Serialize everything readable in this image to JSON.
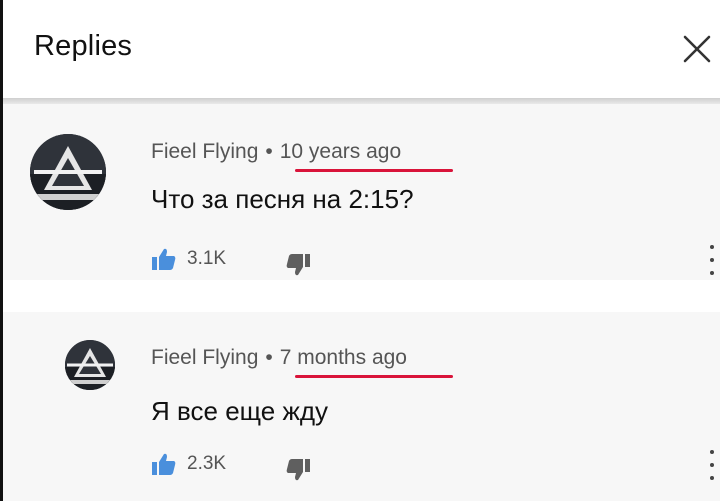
{
  "header": {
    "title": "Replies"
  },
  "comments": [
    {
      "author": "Fieel Flying",
      "separator": "•",
      "time": "10 years ago",
      "text": "Что за песня на 2:15?",
      "likes": "3.1K"
    },
    {
      "author": "Fieel Flying",
      "separator": "•",
      "time": "7 months ago",
      "text": "Я все еще жду",
      "likes": "2.3K"
    }
  ],
  "colors": {
    "underline": "#d9143a",
    "like_icon": "#4a8fdc",
    "dislike_icon": "#5f5f5f"
  },
  "icons": [
    "close-icon",
    "thumbs-up-icon",
    "thumbs-down-icon",
    "more-vert-icon"
  ]
}
